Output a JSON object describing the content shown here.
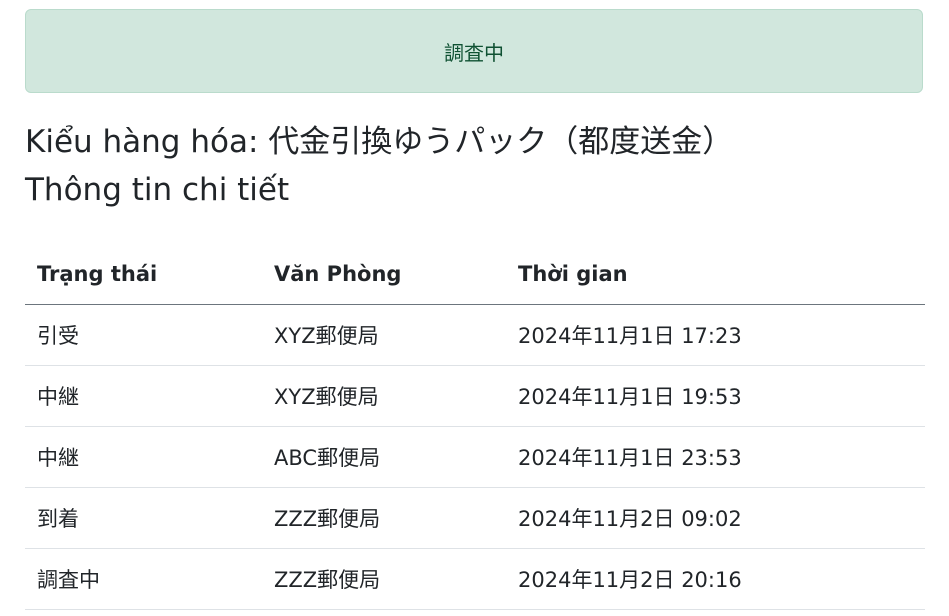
{
  "status_alert": "調査中",
  "item_type_line": "Kiểu hàng hóa: 代金引換ゆうパック（都度送金）",
  "detail_heading": "Thông tin chi tiết",
  "table": {
    "headers": {
      "status": "Trạng thái",
      "office": "Văn Phòng",
      "time": "Thời gian"
    },
    "rows": [
      {
        "status": "引受",
        "office": "XYZ郵便局",
        "time": "2024年11月1日 17:23"
      },
      {
        "status": "中継",
        "office": "XYZ郵便局",
        "time": "2024年11月1日 19:53"
      },
      {
        "status": "中継",
        "office": "ABC郵便局",
        "time": "2024年11月1日 23:53"
      },
      {
        "status": "到着",
        "office": "ZZZ郵便局",
        "time": "2024年11月2日 09:02"
      },
      {
        "status": "調査中",
        "office": "ZZZ郵便局",
        "time": "2024年11月2日 20:16"
      }
    ]
  }
}
